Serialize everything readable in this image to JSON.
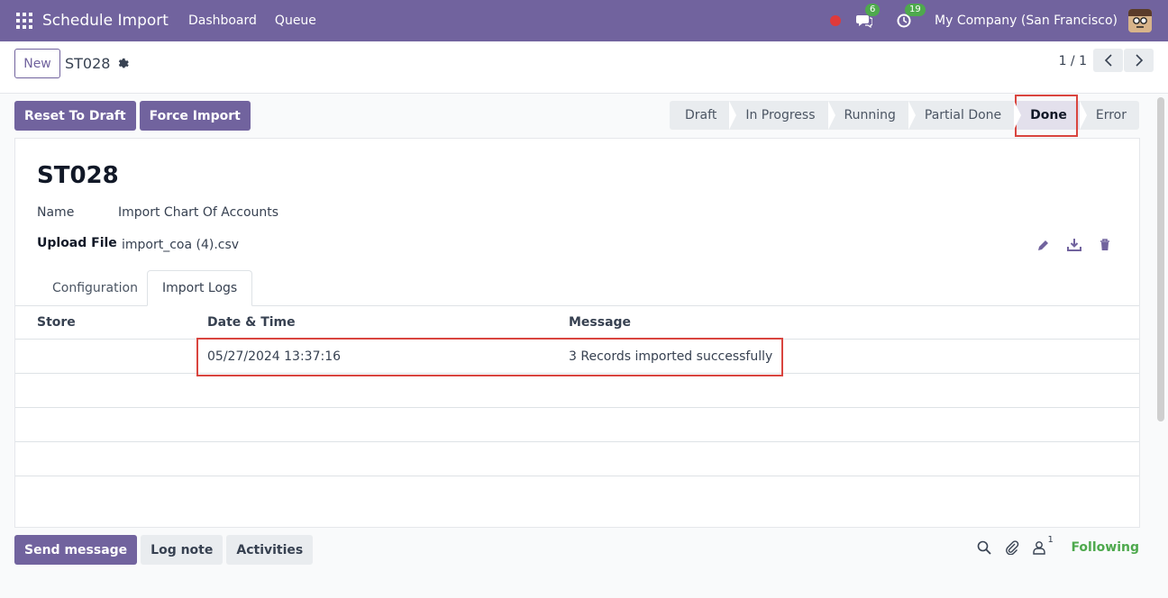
{
  "navbar": {
    "app_title": "Schedule Import",
    "menu": [
      "Dashboard",
      "Queue"
    ],
    "messages_count": "6",
    "activities_count": "19",
    "company": "My Company (San Francisco)"
  },
  "control": {
    "new_label": "New",
    "breadcrumb": "ST028",
    "pager": "1 / 1"
  },
  "actions": {
    "reset_label": "Reset To Draft",
    "force_label": "Force Import"
  },
  "statusbar": {
    "stages": [
      "Draft",
      "In Progress",
      "Running",
      "Partial Done",
      "Done",
      "Error"
    ],
    "active": "Done"
  },
  "record": {
    "title": "ST028",
    "name_label": "Name",
    "name_value": "Import Chart Of Accounts",
    "upload_label": "Upload File",
    "upload_value": "import_coa (4).csv"
  },
  "tabs": [
    "Configuration",
    "Import Logs"
  ],
  "logs": {
    "columns": [
      "Store",
      "Date & Time",
      "Message"
    ],
    "rows": [
      {
        "store": "",
        "datetime": "05/27/2024 13:37:16",
        "message": "3 Records imported successfully"
      }
    ]
  },
  "chatter": {
    "send_label": "Send message",
    "log_label": "Log note",
    "activities_label": "Activities",
    "followers_count": "1",
    "following_label": "Following"
  },
  "colors": {
    "brand": "#71639e",
    "success": "#4ea94d",
    "highlight": "#d9453f"
  }
}
